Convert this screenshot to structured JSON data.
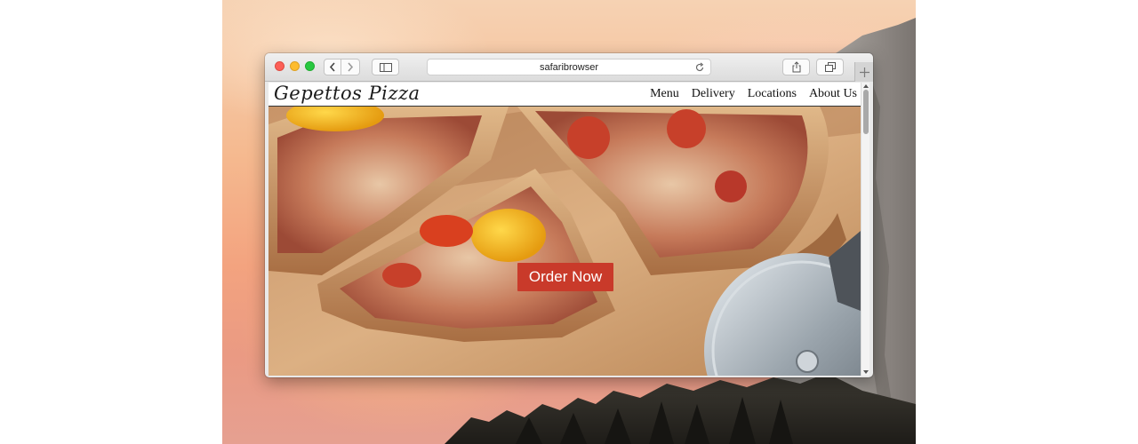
{
  "browser": {
    "url": "safaribrowser",
    "buttons": {
      "close": "close-icon",
      "minimize": "minimize-icon",
      "maximize": "maximize-icon",
      "back": "chevron-left-icon",
      "forward": "chevron-right-icon",
      "sidebar": "sidebar-icon",
      "reload": "reload-icon",
      "share": "share-icon",
      "tabs": "tabs-icon",
      "new_tab": "plus-icon"
    }
  },
  "site": {
    "logo": "Gepettos Pizza",
    "nav": [
      "Menu",
      "Delivery",
      "Locations",
      "About Us"
    ],
    "hero_button": "Order Now",
    "colors": {
      "accent": "#c93a2a",
      "header_bg": "#ffffff"
    }
  }
}
